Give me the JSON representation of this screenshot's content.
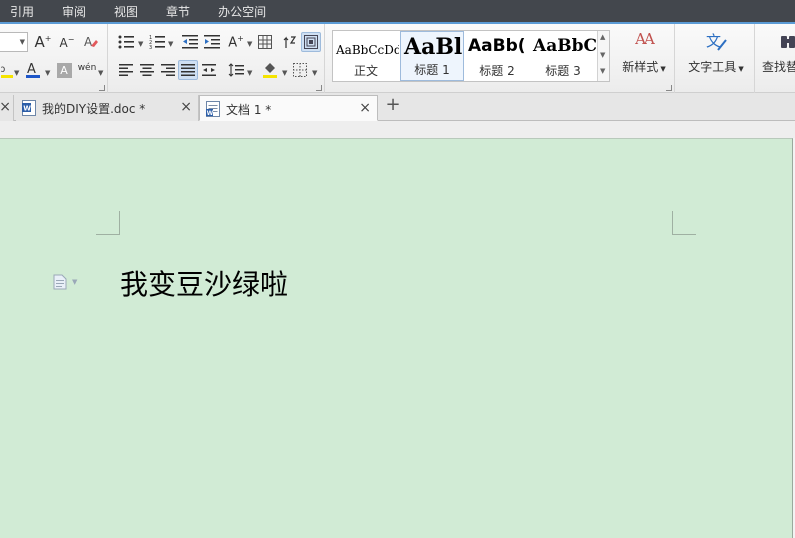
{
  "menu": [
    "引用",
    "审阅",
    "视图",
    "章节",
    "办公空间"
  ],
  "ribbon": {
    "font_size_up": "A",
    "font_size_down": "A",
    "font_color_letter": "A",
    "char_shade_letter": "A",
    "phonetic_label": "wén",
    "text_direction_letter": "A",
    "styles": [
      {
        "sample": "AaBbCcDd",
        "caption": "正文"
      },
      {
        "sample": "AaBl",
        "caption": "标题 1"
      },
      {
        "sample": "AaBb(",
        "caption": "标题 2"
      },
      {
        "sample": "AaBbC",
        "caption": "标题 3"
      }
    ],
    "new_style_label": "新样式",
    "new_style_icon_text": "AA",
    "text_tools_label": "文字工具",
    "find_replace_label": "查找替"
  },
  "tabs": [
    {
      "title": "我的DIY设置.doc *",
      "active": false
    },
    {
      "title": "文档 1 *",
      "active": true
    }
  ],
  "new_tab_symbol": "+",
  "document": {
    "text": "我变豆沙绿啦"
  },
  "colors": {
    "menubar_bg": "#43474d",
    "ribbon_accent": "#5b9bd5",
    "page_bg": "#d1ebd5",
    "font_color_bar": "#1e56c8",
    "highlight_bar": "#f5e400"
  }
}
